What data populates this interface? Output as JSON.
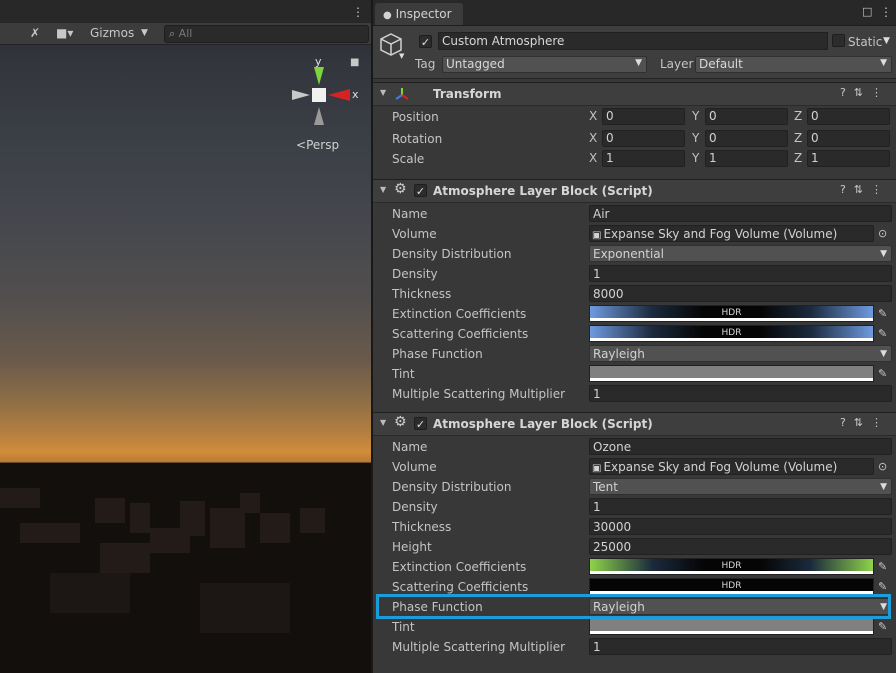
{
  "scene": {
    "gizmos_label": "Gizmos",
    "search_placeholder": "All",
    "persp_label": "Persp",
    "axis_y": "y",
    "axis_x": "x"
  },
  "inspector": {
    "tab_title": "Inspector",
    "object": {
      "name": "Custom Atmosphere",
      "static_label": "Static",
      "tag_label": "Tag",
      "tag_value": "Untagged",
      "layer_label": "Layer",
      "layer_value": "Default"
    },
    "transform": {
      "title": "Transform",
      "rows": [
        {
          "label": "Position",
          "x": "0",
          "y": "0",
          "z": "0"
        },
        {
          "label": "Rotation",
          "x": "0",
          "y": "0",
          "z": "0"
        },
        {
          "label": "Scale",
          "x": "1",
          "y": "1",
          "z": "1"
        }
      ]
    },
    "block1": {
      "title": "Atmosphere Layer Block (Script)",
      "name_label": "Name",
      "name_value": "Air",
      "volume_label": "Volume",
      "volume_value": "Expanse Sky and Fog Volume (Volume)",
      "dist_label": "Density Distribution",
      "dist_value": "Exponential",
      "density_label": "Density",
      "density_value": "1",
      "thickness_label": "Thickness",
      "thickness_value": "8000",
      "ext_label": "Extinction Coefficients",
      "scat_label": "Scattering Coefficients",
      "phase_label": "Phase Function",
      "phase_value": "Rayleigh",
      "tint_label": "Tint",
      "msm_label": "Multiple Scattering Multiplier",
      "msm_value": "1",
      "ext_color": "#6f9be0",
      "scat_color": "#6f9be0",
      "tint_color": "#808080"
    },
    "block2": {
      "title": "Atmosphere Layer Block (Script)",
      "name_label": "Name",
      "name_value": "Ozone",
      "volume_label": "Volume",
      "volume_value": "Expanse Sky and Fog Volume (Volume)",
      "dist_label": "Density Distribution",
      "dist_value": "Tent",
      "density_label": "Density",
      "density_value": "1",
      "thickness_label": "Thickness",
      "thickness_value": "30000",
      "height_label": "Height",
      "height_value": "25000",
      "ext_label": "Extinction Coefficients",
      "scat_label": "Scattering Coefficients",
      "phase_label": "Phase Function",
      "phase_value": "Rayleigh",
      "tint_label": "Tint",
      "msm_label": "Multiple Scattering Multiplier",
      "msm_value": "1",
      "ext_color": "#8ed34a",
      "tint_color": "#808080"
    },
    "hdr_text": "HDR",
    "highlight_color": "#1a9ddb"
  }
}
